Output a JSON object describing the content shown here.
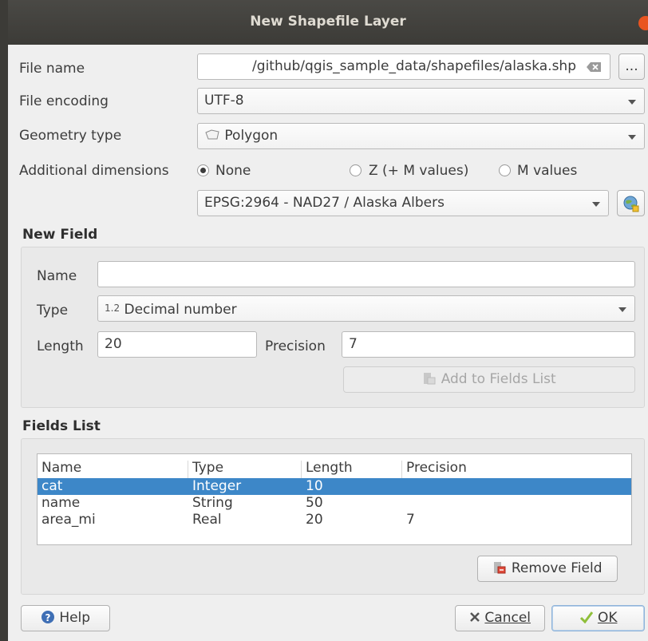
{
  "window": {
    "title": "New Shapefile Layer"
  },
  "file_name": {
    "label": "File name",
    "value": "/github/qgis_sample_data/shapefiles/alaska.shp",
    "browse_label": "..."
  },
  "file_encoding": {
    "label": "File encoding",
    "value": "UTF-8"
  },
  "geometry_type": {
    "label": "Geometry type",
    "value": "Polygon"
  },
  "additional_dimensions": {
    "label": "Additional dimensions",
    "options": [
      "None",
      "Z (+ M values)",
      "M values"
    ],
    "selected": "None"
  },
  "crs": {
    "value": "EPSG:2964 - NAD27 / Alaska Albers"
  },
  "new_field": {
    "title": "New Field",
    "name_label": "Name",
    "name_value": "",
    "type_label": "Type",
    "type_prefix": "1.2",
    "type_value": "Decimal number",
    "length_label": "Length",
    "length_value": "20",
    "precision_label": "Precision",
    "precision_value": "7",
    "add_button": "Add to Fields List"
  },
  "fields_list": {
    "title": "Fields List",
    "columns": [
      "Name",
      "Type",
      "Length",
      "Precision"
    ],
    "rows": [
      {
        "name": "cat",
        "type": "Integer",
        "length": "10",
        "precision": ""
      },
      {
        "name": "name",
        "type": "String",
        "length": "50",
        "precision": ""
      },
      {
        "name": "area_mi",
        "type": "Real",
        "length": "20",
        "precision": "7"
      }
    ],
    "selected_row": 0,
    "remove_button": "Remove Field"
  },
  "footer": {
    "help_label": "Help",
    "cancel_label": "Cancel",
    "ok_label": "OK"
  },
  "colors": {
    "selection": "#3d87c8",
    "titlebar": "#3c3b37",
    "close": "#e95420"
  }
}
